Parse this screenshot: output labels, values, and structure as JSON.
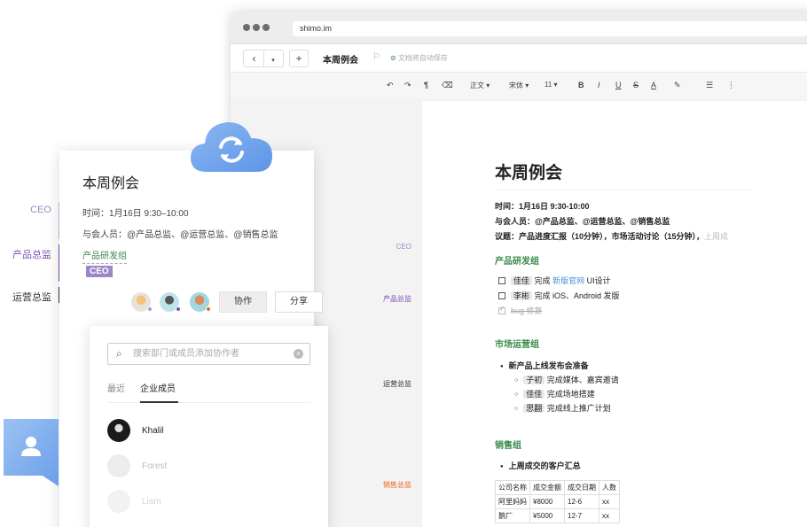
{
  "browser": {
    "url": "shimo.im",
    "doc_title": "本周例会",
    "save_status": "文档将自动保存",
    "toolbar": {
      "back_icon": "chevron-left-icon",
      "add_label": "+",
      "style": "正文",
      "font": "宋体",
      "size": "11",
      "bold": "B",
      "italic": "I",
      "underline": "U",
      "strike": "S",
      "color": "A"
    }
  },
  "rail": {
    "ceo": "CEO",
    "product": "产品总监",
    "ops": "运营总监",
    "sales": "销售总监"
  },
  "document": {
    "title": "本周例会",
    "time": "时间：1月16日 9:30-10:00",
    "attendees": "与会人员：@产品总监、@运营总监、@销售总监",
    "agenda": "议题：产品进度汇报（10分钟），市场活动讨论（15分钟），",
    "agenda_faded": "上周成",
    "sections": {
      "product": {
        "heading": "产品研发组",
        "todos": [
          {
            "who": "佳佳",
            "pre": "完成",
            "link": "新版官网",
            "post": "UI设计",
            "done": false
          },
          {
            "who": "李彬",
            "pre": "完成 iOS、Android 发版",
            "link": "",
            "post": "",
            "done": false
          },
          {
            "who": "",
            "pre": "bug 修复",
            "link": "",
            "post": "",
            "done": true
          }
        ]
      },
      "market": {
        "heading": "市场运营组",
        "bullet": "新产品上线发布会准备",
        "subs": [
          {
            "who": "子初",
            "text": "完成媒体、嘉宾邀请"
          },
          {
            "who": "佳佳",
            "text": "完成场地搭建"
          },
          {
            "who": "思翻",
            "text": "完成线上推广计划"
          }
        ]
      },
      "sales": {
        "heading": "销售组",
        "bullet": "上周成交的客户汇总",
        "table": {
          "headers": [
            "公司名称",
            "成交金额",
            "成交日期",
            "人数"
          ],
          "rows": [
            [
              "阿里妈妈",
              "¥8000",
              "12-6",
              "xx"
            ],
            [
              "鹅厂",
              "¥5000",
              "12-7",
              "xx"
            ]
          ]
        }
      }
    }
  },
  "org": {
    "ceo": "CEO",
    "product": "产品总监",
    "ops": "运营总监"
  },
  "card": {
    "title": "本周例会",
    "time": "时间：1月16日 9:30–10:00",
    "attendees": "与会人员：@产品总监、@运营总监、@销售总监",
    "group": "产品研发组",
    "tag": "CEO",
    "collab_button": "协作",
    "share_button": "分享"
  },
  "panel": {
    "search_placeholder": "搜索部门或成员添加协作者",
    "tabs": [
      "最近",
      "企业成员"
    ],
    "active_tab": 1,
    "members": [
      {
        "name": "Khalil"
      },
      {
        "name": "Forest"
      },
      {
        "name": "Liam"
      }
    ]
  },
  "colors": {
    "ceo": "#9b86c8",
    "product": "#7a4fb0",
    "ops": "#333333",
    "sales": "#f0641e",
    "green": "#3a8a4a",
    "cloud": "#7fb0ec"
  }
}
